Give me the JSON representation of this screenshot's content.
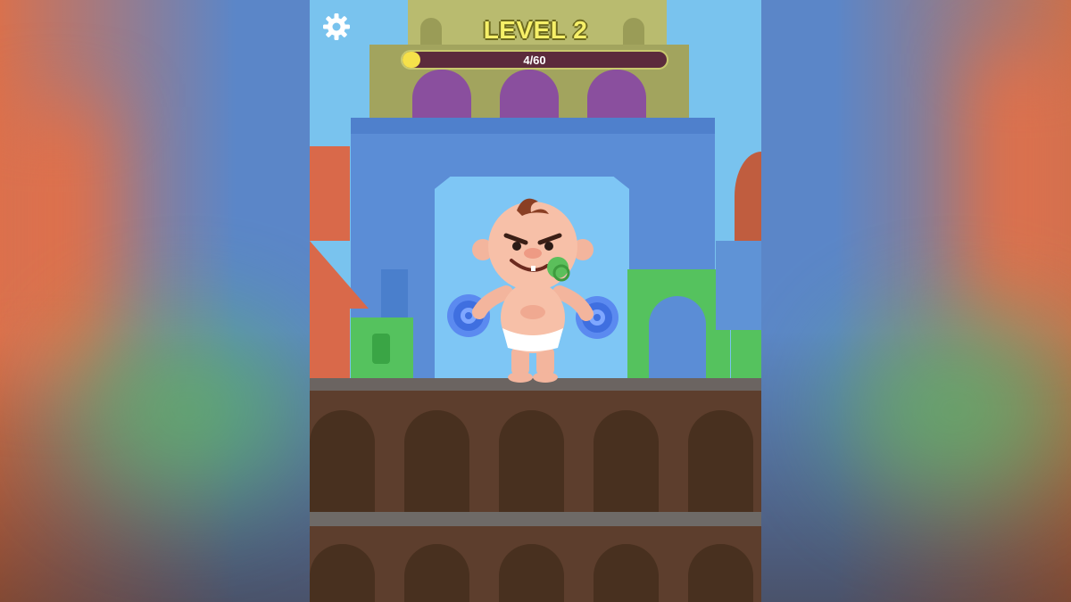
{
  "hud": {
    "level_label": "LEVEL 2",
    "progress_text": "4/60",
    "progress_value": 4,
    "progress_max": 60,
    "settings_icon": "gear-icon"
  },
  "colors": {
    "level_text": "#f6f068",
    "progress_fill": "#f6e14a",
    "progress_track": "#5c2b3c",
    "sky": "#79c3ee",
    "floor": "#5d3e2d"
  },
  "character": {
    "name_icon": "baby-character",
    "props": [
      "dumbbell-icon",
      "pacifier-icon"
    ]
  }
}
